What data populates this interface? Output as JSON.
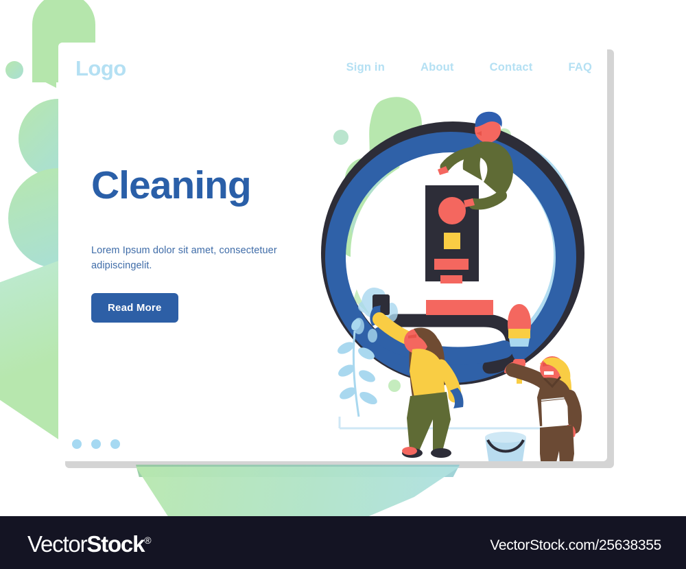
{
  "page": {
    "background_color": "#ffffff"
  },
  "card": {
    "header": {
      "logo_text": "Logo",
      "logo_color": "#b4e0f3",
      "nav_items": [
        {
          "label": "Sign in"
        },
        {
          "label": "About"
        },
        {
          "label": "Contact"
        },
        {
          "label": "FAQ"
        }
      ]
    },
    "hero": {
      "headline": "Cleaning",
      "headline_color": "#2a5fa8",
      "subtext": "Lorem Ipsum dolor sit amet, consectetuer adipiscingelit.",
      "subtext_color": "#3f6ca8",
      "cta_label": "Read More",
      "cta_color": "#2d5fa6"
    },
    "carousel_dots": [
      {
        "active": true
      },
      {
        "active": true
      },
      {
        "active": true
      }
    ]
  },
  "illustration": {
    "name": "cleaning-scene",
    "ring_outer_color": "#2d2d38",
    "ring_inner_color": "#2f61a8",
    "accent_red": "#f4675f",
    "accent_yellow": "#f9cd44",
    "accent_green": "#b7e7ae",
    "accent_lightblue": "#a9d8ef",
    "characters": [
      {
        "name": "man-on-ring",
        "hair": "#2f5fb0",
        "top": "#5f6b35"
      },
      {
        "name": "woman-with-sponge",
        "hair": "#6f4b32",
        "top": "#f9cd44",
        "pants": "#5f6b35"
      },
      {
        "name": "woman-with-duster",
        "hair": "#f9cd44",
        "top": "#6b4a34",
        "apron": "#ffffff"
      }
    ],
    "props": [
      {
        "name": "bucket",
        "color": "#b9dcef"
      },
      {
        "name": "feather-duster",
        "colors": [
          "#f4675f",
          "#f9cd44",
          "#a9d8ef",
          "#2f61a8"
        ]
      },
      {
        "name": "sponge",
        "color": "#2f61a8"
      },
      {
        "name": "panel",
        "color": "#2d2d38"
      }
    ]
  },
  "footer": {
    "logo_part1": "Vector",
    "logo_part2": "Stock",
    "logo_reg": "®",
    "url": "VectorStock.com/25638355",
    "background_color": "#141423"
  }
}
